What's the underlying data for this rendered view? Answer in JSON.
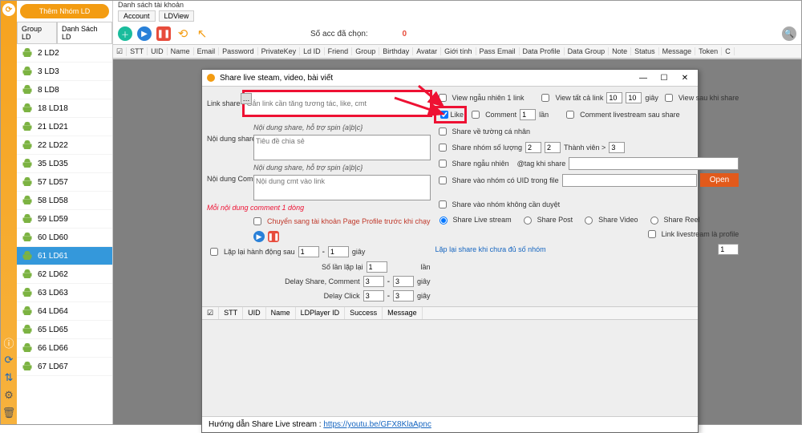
{
  "rail": {
    "icons": {
      "info": "ⓘ",
      "refresh": "⟳",
      "updown": "⇅",
      "gear": "⚙",
      "trash": "🗑"
    }
  },
  "sidebar": {
    "add_group": "Thêm Nhóm LD",
    "tabs": {
      "group": "Group LD",
      "list": "Danh Sách LD"
    },
    "items": [
      {
        "idx": "2",
        "label": "LD2"
      },
      {
        "idx": "3",
        "label": "LD3"
      },
      {
        "idx": "8",
        "label": "LD8"
      },
      {
        "idx": "18",
        "label": "LD18"
      },
      {
        "idx": "21",
        "label": "LD21"
      },
      {
        "idx": "22",
        "label": "LD22"
      },
      {
        "idx": "35",
        "label": "LD35"
      },
      {
        "idx": "57",
        "label": "LD57"
      },
      {
        "idx": "58",
        "label": "LD58"
      },
      {
        "idx": "59",
        "label": "LD59"
      },
      {
        "idx": "60",
        "label": "LD60"
      },
      {
        "idx": "61",
        "label": "LD61",
        "selected": true
      },
      {
        "idx": "62",
        "label": "LD62"
      },
      {
        "idx": "63",
        "label": "LD63"
      },
      {
        "idx": "64",
        "label": "LD64"
      },
      {
        "idx": "65",
        "label": "LD65"
      },
      {
        "idx": "66",
        "label": "LD66"
      },
      {
        "idx": "67",
        "label": "LD67"
      }
    ]
  },
  "topbar": {
    "title": "Danh sách tài khoản",
    "tab_account": "Account",
    "tab_ldview": "LDView",
    "sel_label": "Số acc đã chọn:",
    "sel_count": "0",
    "columns": [
      "☑",
      "STT",
      "UID",
      "Name",
      "Email",
      "Password",
      "PrivateKey",
      "Ld ID",
      "Friend",
      "Group",
      "Birthday",
      "Avatar",
      "Giới tính",
      "Pass Email",
      "Data Profile",
      "Data Group",
      "Note",
      "Status",
      "Message",
      "Token",
      "C"
    ]
  },
  "dialog": {
    "title": "Share live steam, video, bài viết",
    "linkshare_lbl": "Link share",
    "linkshare_ph": "Gắn link cần tăng tương tác, like, cmt",
    "ndshare_hint": "Nội dung share, hỗ trợ spin {a|b|c}",
    "ndshare_lbl": "Nội dung share",
    "ndshare_ph": "Tiêu đề chia sẻ",
    "ndcmt_hint": "Nội dung share, hỗ trợ spin {a|b|c}",
    "ndcmt_lbl": "Nội dung Comment",
    "ndcmt_ph": "Nội dung cmt vào link",
    "red_note": "Mỗi nội dung comment 1 dòng",
    "chk_profile": "Chuyển sang tài khoản Page Profile trước khi chạy",
    "chk_repeat": "Lặp lại hành động sau",
    "lap": "Số lần lặp lại",
    "delay_share": "Delay Share, Comment",
    "delay_click": "Delay Click",
    "repeat_v1": "1",
    "repeat_v2": "1",
    "lap_v": "1",
    "ds_v1": "3",
    "ds_v2": "3",
    "dc_v1": "3",
    "dc_v2": "3",
    "unit_s": "giây",
    "unit_l": "lần",
    "view_many": "View ngẫu nhiên 1 link",
    "view_all": "View tất cả link",
    "like": "Like",
    "comment": "Comment",
    "cmt_after": "Comment livestream sau share",
    "share_wall": "Share về tường cá nhân",
    "share_grp": "Share nhóm số lượng",
    "share_rand": "Share ngẫu nhiên",
    "tag_share": "@tag khi share",
    "share_uid": "Share vào nhóm có UID trong file",
    "open_btn": "Open",
    "share_no_mod": "Share vào nhóm không cần duyệt",
    "r_live": "Share Live stream",
    "r_post": "Share Post",
    "r_video": "Share Video",
    "r_reel": "Share Reel",
    "chk_link_live": "Link livestream là profile",
    "retry": "Lặp lại share khi chưa đủ số nhóm",
    "v_va1": "10",
    "v_va2": "10",
    "v_cmt": "1",
    "v_sg1": "2",
    "v_sg2": "2",
    "v_tv": "3",
    "thanh_vien": "Thành viên >",
    "retry_v": "1",
    "cols": [
      "☑",
      "STT",
      "UID",
      "Name",
      "LDPlayer ID",
      "Success",
      "Message"
    ],
    "footer_label": "Hướng dẫn Share Live stream : ",
    "footer_link": "https://youtu.be/GFX8KlaApnc"
  }
}
